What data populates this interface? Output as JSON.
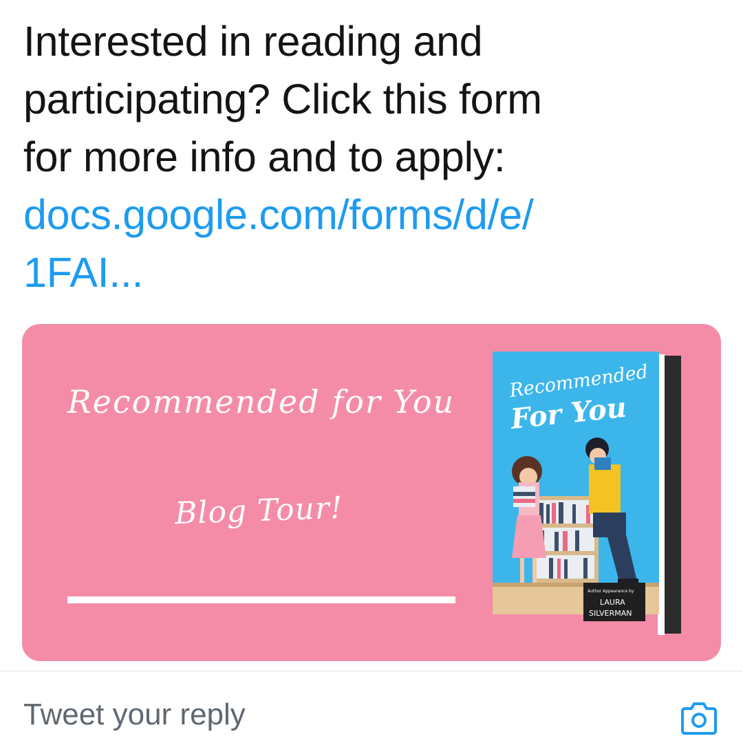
{
  "tweet": {
    "lines": [
      "Interested in reading and",
      "participating? Click this form",
      "for more info and to apply:"
    ],
    "link_lines": [
      "docs.google.com/forms/d/e/",
      "1FAI..."
    ]
  },
  "media": {
    "title": "Recommended for You",
    "subtitle": "Blog Tour!",
    "book": {
      "title_top": "Recommended",
      "title_bottom": "For You",
      "author_credit": "Author Appearance by",
      "author_first": "LAURA",
      "author_last": "SILVERMAN"
    }
  },
  "reply": {
    "placeholder": "Tweet your reply",
    "camera_icon": "camera-icon"
  },
  "colors": {
    "card_background": "#f48ca8",
    "link": "#1d9bf0",
    "accent": "#1d9bf0",
    "book_background": "#3cb6ea"
  }
}
